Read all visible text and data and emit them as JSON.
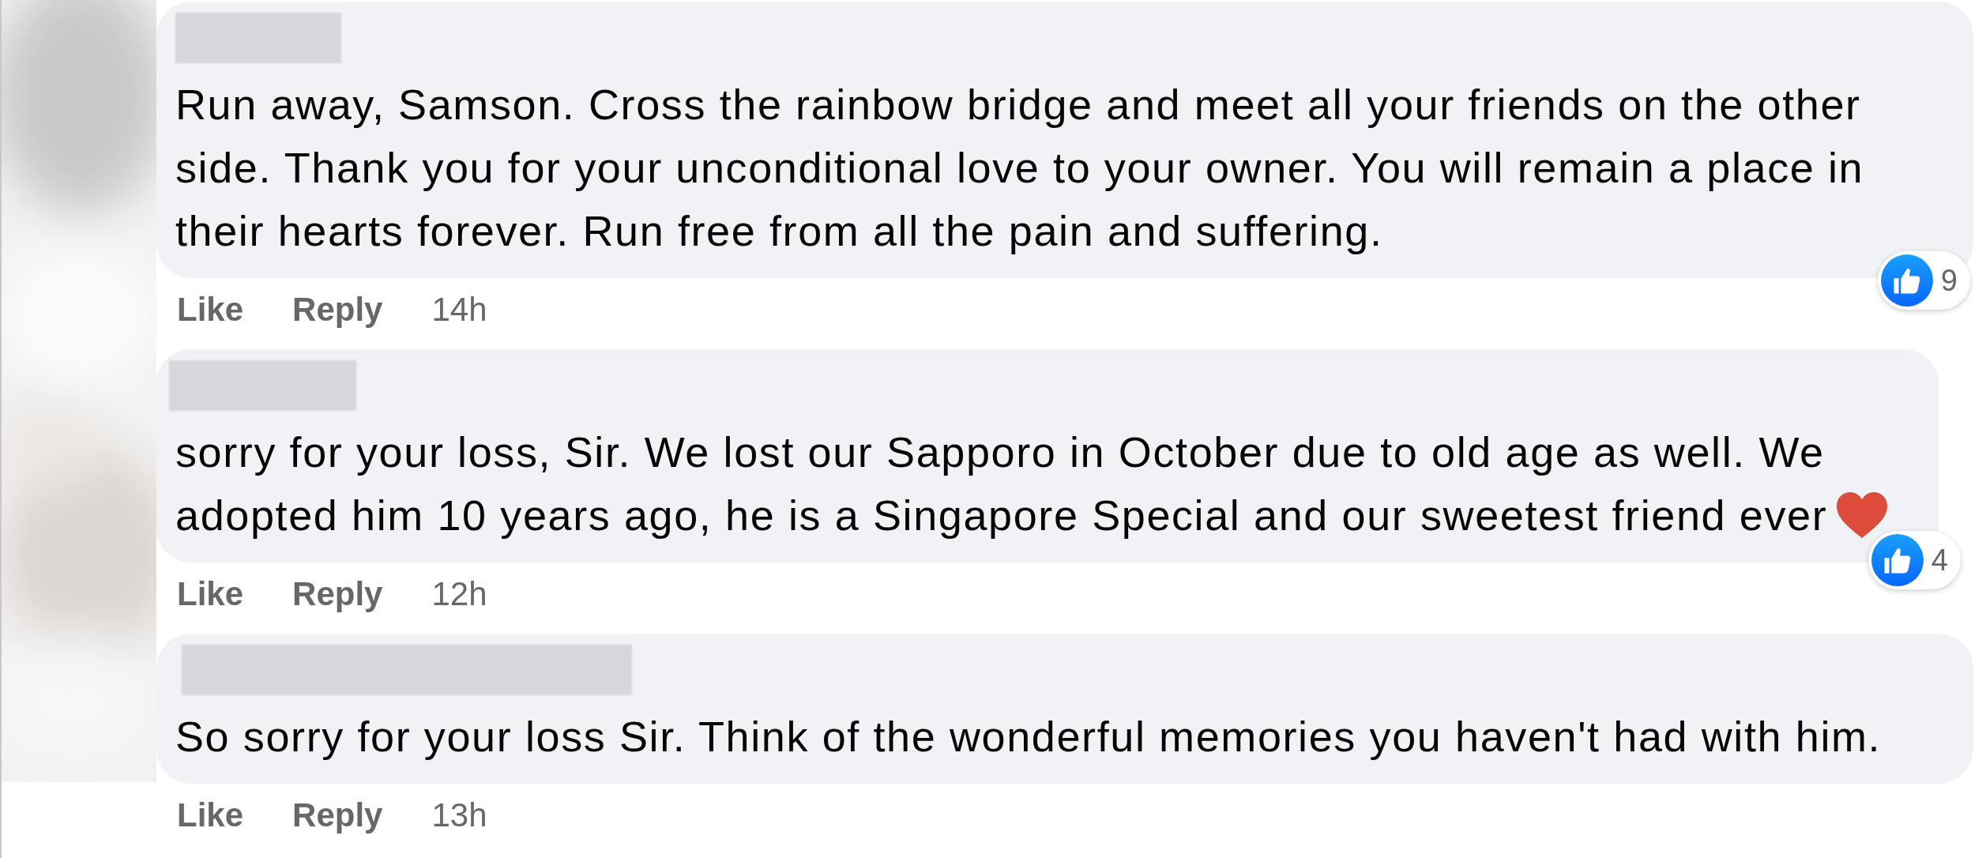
{
  "comments": [
    {
      "author_redacted": true,
      "text": "Run away, Samson. Cross the rainbow bridge and meet all your friends on the other side. Thank you for your unconditional love to your owner. You will remain a place in their hearts forever. Run free from all the pain and suffering.",
      "heart_emoji": false,
      "reaction_count": "9",
      "actions": [
        "Like",
        "Reply"
      ],
      "time": "14h"
    },
    {
      "author_redacted": true,
      "text": "sorry for your loss, Sir. We lost our Sapporo in October due to old age as well. We adopted him 10 years ago, he is a Singapore Special and our sweetest friend ever",
      "heart_emoji": true,
      "reaction_count": "4",
      "actions": [
        "Like",
        "Reply"
      ],
      "time": "12h"
    },
    {
      "author_redacted": true,
      "text": "So sorry for your loss Sir. Think of the wonderful memories you haven't had with him.",
      "heart_emoji": false,
      "actions": [
        "Like",
        "Reply"
      ],
      "time": "13h"
    }
  ]
}
